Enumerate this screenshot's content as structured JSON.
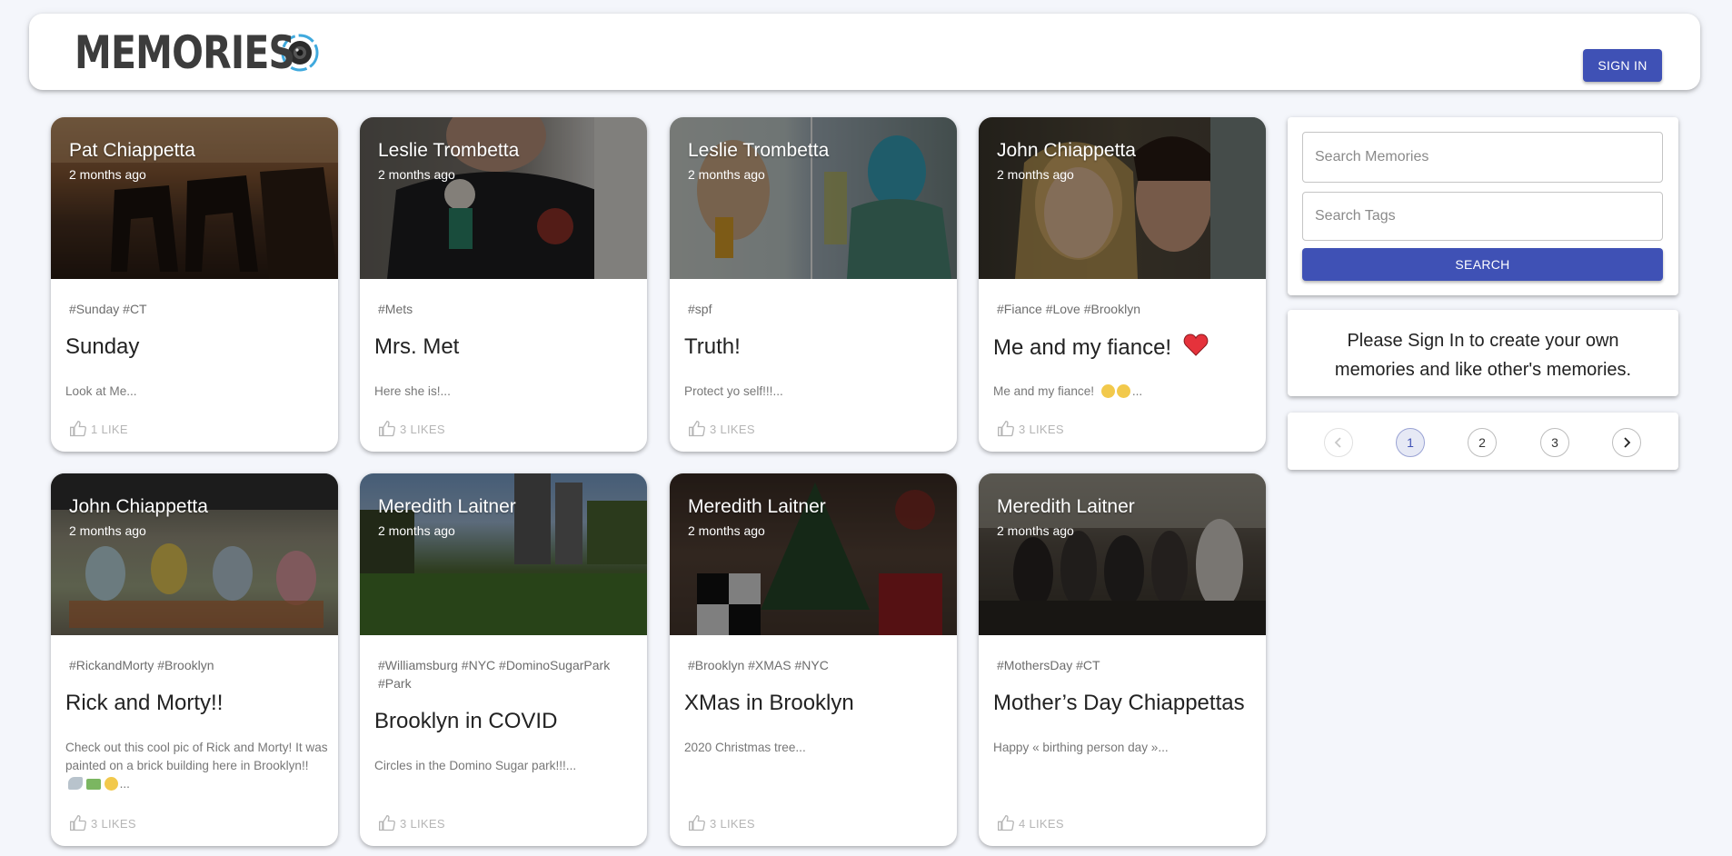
{
  "header": {
    "brand": "MEMORIES",
    "sign_in_label": "SIGN IN"
  },
  "posts": [
    {
      "author": "Pat Chiappetta",
      "time": "2 months ago",
      "tags": "#Sunday #CT",
      "title": "Sunday",
      "message": "Look at Me...",
      "likes": "1 LIKE"
    },
    {
      "author": "Leslie Trombetta",
      "time": "2 months ago",
      "tags": "#Mets",
      "title": "Mrs. Met",
      "message": "Here she is!...",
      "likes": "3 LIKES"
    },
    {
      "author": "Leslie Trombetta",
      "time": "2 months ago",
      "tags": "#spf",
      "title": "Truth!",
      "message": "Protect yo self!!!...",
      "likes": "3 LIKES"
    },
    {
      "author": "John Chiappetta",
      "time": "2 months ago",
      "tags": "#Fiance #Love #Brooklyn",
      "title": "Me and my fiance!",
      "message": "Me and my fiance!",
      "likes": "3 LIKES"
    },
    {
      "author": "John Chiappetta",
      "time": "2 months ago",
      "tags": "#RickandMorty #Brooklyn",
      "title": "Rick and Morty!!",
      "message": "Check out this cool pic of Rick and Morty! It was painted on a brick building here in Brooklyn!!",
      "likes": "3 LIKES"
    },
    {
      "author": "Meredith Laitner",
      "time": "2 months ago",
      "tags": "#Williamsburg #NYC #DominoSugarPark #Park",
      "title": "Brooklyn in COVID",
      "message": "Circles in the Domino Sugar park!!!...",
      "likes": "3 LIKES"
    },
    {
      "author": "Meredith Laitner",
      "time": "2 months ago",
      "tags": "#Brooklyn #XMAS #NYC",
      "title": "XMas in Brooklyn",
      "message": "2020 Christmas tree...",
      "likes": "3 LIKES"
    },
    {
      "author": "Meredith Laitner",
      "time": "2 months ago",
      "tags": "#MothersDay #CT",
      "title": "Mother’s Day Chiappettas",
      "message": "Happy « birthing person day »...",
      "likes": "4 LIKES"
    }
  ],
  "search": {
    "memories_placeholder": "Search Memories",
    "tags_placeholder": "Search Tags",
    "button_label": "SEARCH"
  },
  "signin_prompt": "Please Sign In to create your own memories and like other's memories.",
  "pagination": {
    "pages": [
      "1",
      "2",
      "3"
    ],
    "current": "1"
  },
  "colors": {
    "primary": "#3f51b5",
    "background": "#f4f6fb"
  }
}
